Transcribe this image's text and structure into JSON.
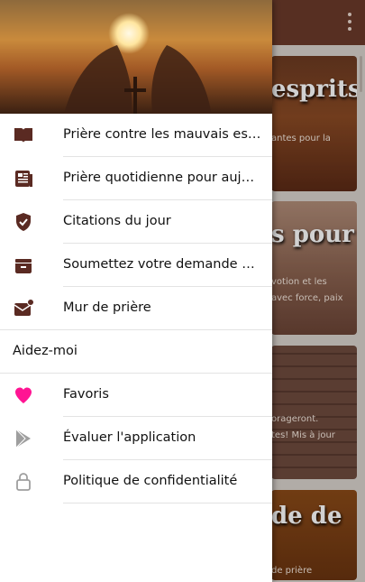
{
  "background": {
    "cards": [
      {
        "title": "esprits",
        "desc": "antes pour la"
      },
      {
        "title": "s pour",
        "desc1": "votion et les",
        "desc2": "avec force, paix"
      },
      {
        "title": "",
        "desc1": "orageront.",
        "desc2": "tes! Mis à jour"
      },
      {
        "title": "de de",
        "desc": "de prière"
      }
    ]
  },
  "drawer": {
    "header_image": "praying-hands-sunset",
    "items": [
      {
        "label": "Prière contre les mauvais esprits",
        "icon": "book-icon"
      },
      {
        "label": "Prière quotidienne pour aujourd'hui",
        "icon": "newspaper-icon"
      },
      {
        "label": "Citations du jour",
        "icon": "shield-check-icon"
      },
      {
        "label": "Soumettez votre demande de prière",
        "icon": "inbox-icon"
      },
      {
        "label": "Mur de prière",
        "icon": "mail-badge-icon"
      }
    ],
    "section_label": "Aidez-moi",
    "help_items": [
      {
        "label": "Favoris",
        "icon": "heart-icon"
      },
      {
        "label": "Évaluer l'application",
        "icon": "play-store-icon"
      },
      {
        "label": "Politique de confidentialité",
        "icon": "lock-icon"
      }
    ]
  },
  "colors": {
    "primary": "#6b3a2a",
    "icon": "#5a2a22",
    "favorite": "#ff1493",
    "muted_icon": "#9e9e9e"
  }
}
